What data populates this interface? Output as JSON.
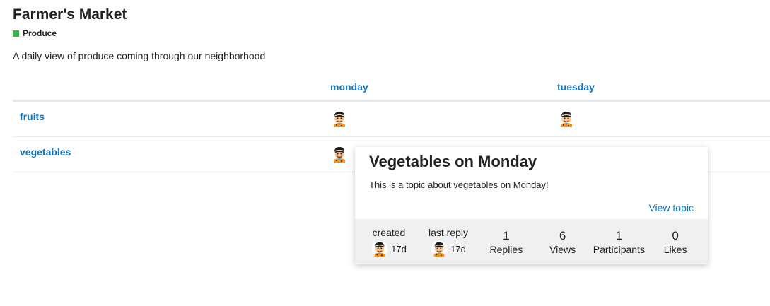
{
  "header": {
    "title": "Farmer's Market",
    "category_name": "Produce",
    "category_color": "#3ab54a"
  },
  "description": "A daily view of produce coming through our neighborhood",
  "columns": [
    "monday",
    "tuesday"
  ],
  "rows": [
    {
      "label": "fruits"
    },
    {
      "label": "vegetables"
    }
  ],
  "avatar_icon": "caveman-avatar-icon",
  "popup": {
    "title": "Vegetables on Monday",
    "excerpt": "This is a topic about vegetables on Monday!",
    "view_link": "View topic",
    "stats": {
      "created_label": "created",
      "created_age": "17d",
      "last_reply_label": "last reply",
      "last_reply_age": "17d",
      "replies_value": "1",
      "replies_label": "Replies",
      "views_value": "6",
      "views_label": "Views",
      "participants_value": "1",
      "participants_label": "Participants",
      "likes_value": "0",
      "likes_label": "Likes"
    }
  },
  "colors": {
    "link": "#0e76bd",
    "footer_bg": "#f0f0f0"
  }
}
